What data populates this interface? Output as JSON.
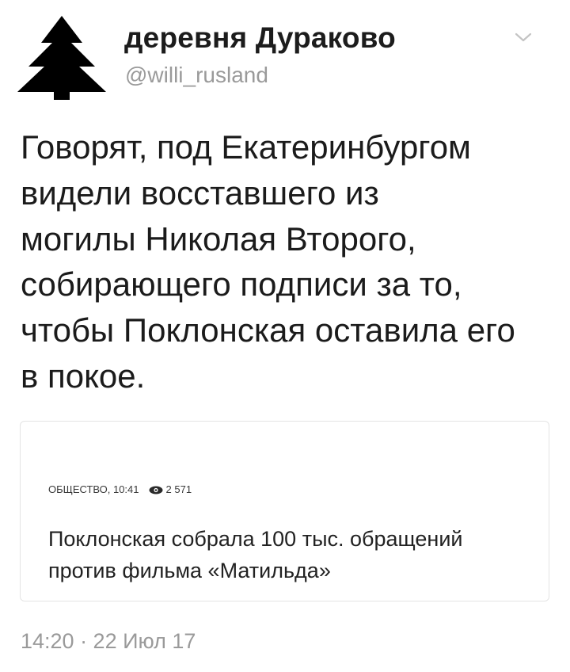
{
  "tweet": {
    "author": {
      "display_name": "деревня Дураково",
      "handle": "@willi_rusland",
      "avatar_icon": "fir-tree-icon"
    },
    "menu_icon": "chevron-down-icon",
    "text_lines": [
      "Говорят,  под Екатеринбургом",
      "видели восставшего из",
      "могилы Николая Второго,",
      "собирающего подписи за то,",
      "чтобы Поклонская оставила его",
      "в покое."
    ],
    "card": {
      "category": "ОБЩЕСТВО, 10:41",
      "views_icon": "eye-icon",
      "views": "2 571",
      "headline_lines": [
        "Поклонская собрала 100 тыс. обращений",
        "против фильма «Матильда»"
      ]
    },
    "timestamp": "14:20 · 22 Июл 17"
  },
  "colors": {
    "text": "#1b1b1b",
    "muted": "#9a9a9a",
    "card_border": "#e4e4e4"
  }
}
